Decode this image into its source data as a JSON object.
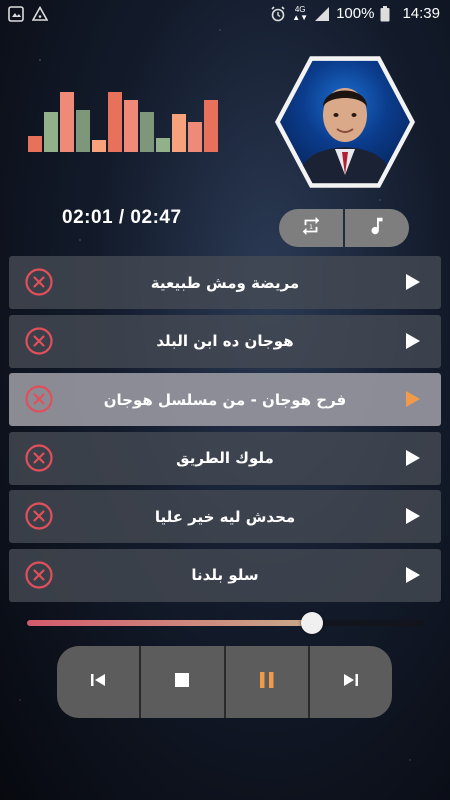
{
  "status_bar": {
    "battery_percent": "100%",
    "clock": "14:39",
    "network_label": "4G"
  },
  "equalizer": {
    "levels": [
      0.25,
      0.62,
      0.94,
      0.66,
      0.18,
      0.94,
      0.81,
      0.62,
      0.22,
      0.6,
      0.47,
      0.81
    ],
    "colors": [
      "#e8715b",
      "#92b08a",
      "#f08a78",
      "#7e967a",
      "#f7a27b",
      "#e8715b",
      "#f08a78",
      "#7e967a",
      "#92b08a",
      "#f7a27b",
      "#f08a78",
      "#e8715b"
    ]
  },
  "player": {
    "time_display": "02:01 / 02:47",
    "progress_fraction": 0.72
  },
  "controls": {
    "repeat_icon": "repeat-icon",
    "music_icon": "music-note-icon"
  },
  "playlist": [
    {
      "title": "مريضة ومش طبيعية",
      "active": false
    },
    {
      "title": "هوجان ده ابن البلد",
      "active": false
    },
    {
      "title": "فرح هوجان - من مسلسل هوجان",
      "active": true
    },
    {
      "title": "ملوك الطريق",
      "active": false
    },
    {
      "title": "محدش ليه خير عليا",
      "active": false
    },
    {
      "title": "سلو بلدنا",
      "active": false
    }
  ],
  "colors": {
    "accent": "#f19a4a",
    "delete_red": "#e0505a"
  }
}
